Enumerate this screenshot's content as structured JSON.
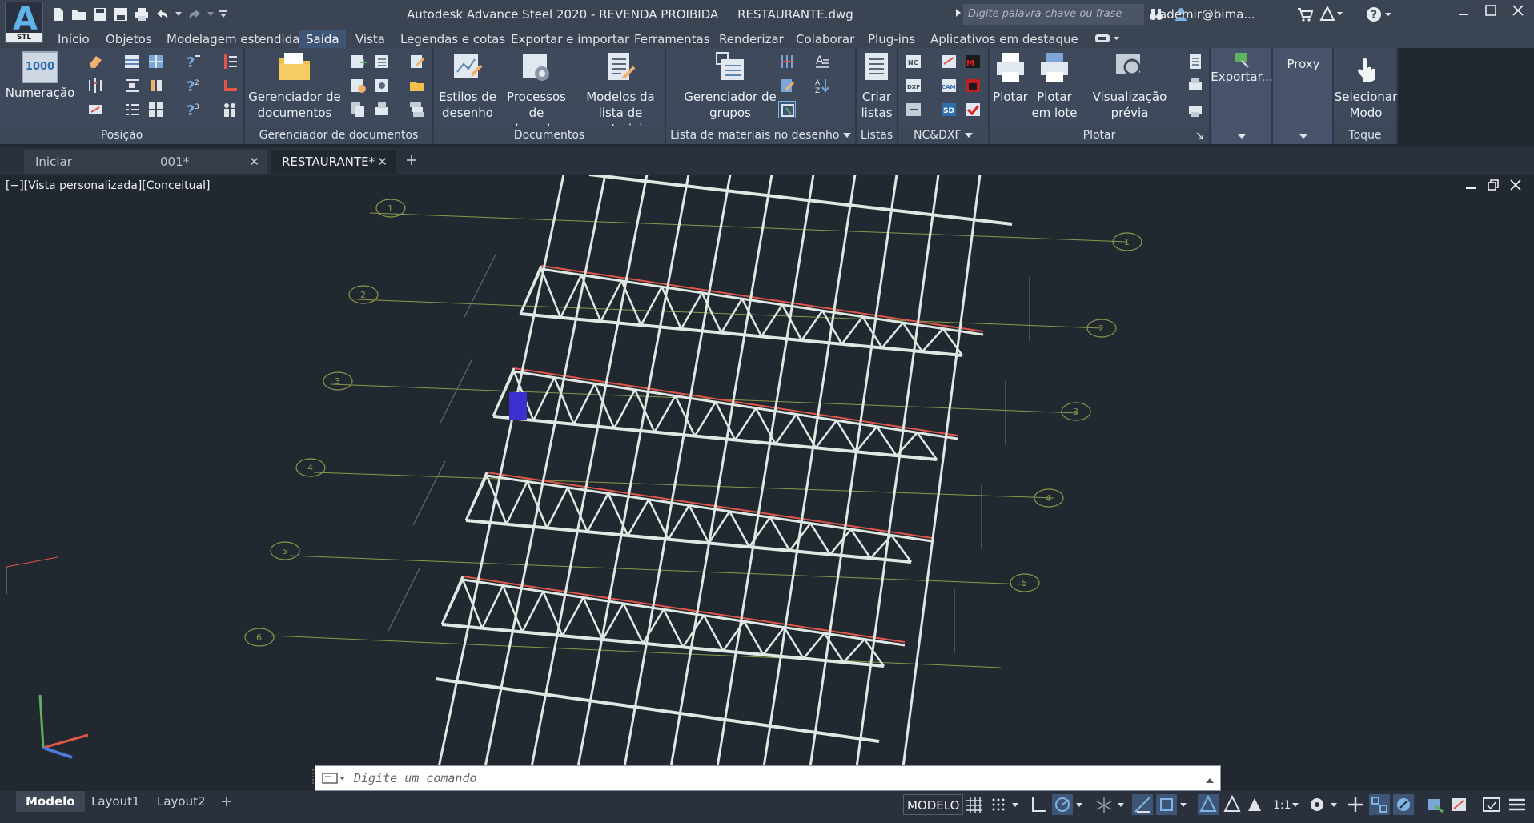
{
  "app": {
    "logo_text": "A",
    "logo_badge": "STL",
    "title": "Autodesk Advance Steel 2020 - REVENDA PROIBIDA     RESTAURANTE.dwg",
    "search_placeholder": "Digite palavra-chave ou frase",
    "user": "ademir@bima..."
  },
  "ribbon_tabs": [
    "Início",
    "Objetos",
    "Modelagem estendida",
    "Saída",
    "Vista",
    "Legendas e cotas",
    "Exportar e importar",
    "Ferramentas",
    "Renderizar",
    "Colaborar",
    "Plug-ins",
    "Aplicativos em destaque"
  ],
  "active_tab": "Saída",
  "ribbon": {
    "numeracao": {
      "label": "Numeração",
      "icon_text": "1000"
    },
    "posicao_title": "Posição",
    "gerenciador_doc": {
      "label1": "Gerenciador de",
      "label2": "documentos"
    },
    "gerenciador_doc_title": "Gerenciador de documentos",
    "estilos": {
      "label1": "Estilos de",
      "label2": "desenho"
    },
    "processos": {
      "label1": "Processos de",
      "label2": "desenho"
    },
    "modelos": {
      "label1": "Modelos da",
      "label2": "lista de materiais"
    },
    "documentos_title": "Documentos",
    "grupos": {
      "label1": "Gerenciador de",
      "label2": "grupos"
    },
    "lista_title": "Lista de materiais no desenho",
    "criar": {
      "label1": "Criar",
      "label2": "listas"
    },
    "listas_title": "Listas",
    "ncdxf_title": "NC&DXF",
    "plotar": {
      "label": "Plotar"
    },
    "plotar_lote": {
      "label1": "Plotar",
      "label2": "em lote"
    },
    "visualizacao": {
      "label": "Visualização prévia"
    },
    "plotar_title": "Plotar",
    "exportar": {
      "label": "Exportar..."
    },
    "proxy": {
      "label": "Proxy"
    },
    "selecionar": {
      "label1": "Selecionar",
      "label2": "Modo"
    },
    "toque_title": "Toque"
  },
  "doc_tabs": [
    {
      "label": "Iniciar"
    },
    {
      "label": "001*"
    },
    {
      "label": "RESTAURANTE*"
    }
  ],
  "viewport": {
    "label": "[−][Vista personalizada][Conceitual]"
  },
  "grid_bubbles": [
    "1",
    "2",
    "3",
    "4",
    "5",
    "6"
  ],
  "command": {
    "placeholder": "Digite um comando"
  },
  "layout_tabs": [
    "Modelo",
    "Layout1",
    "Layout2"
  ],
  "status": {
    "modelo": "MODELO",
    "scale": "1:1"
  },
  "colors": {
    "background": "#212830",
    "ribbon": "#3e4a5c",
    "active_tab": "#3e5575",
    "steel": "#dfe8e3",
    "chord_red": "#e05548",
    "grid_line": "#8a9a4a"
  }
}
